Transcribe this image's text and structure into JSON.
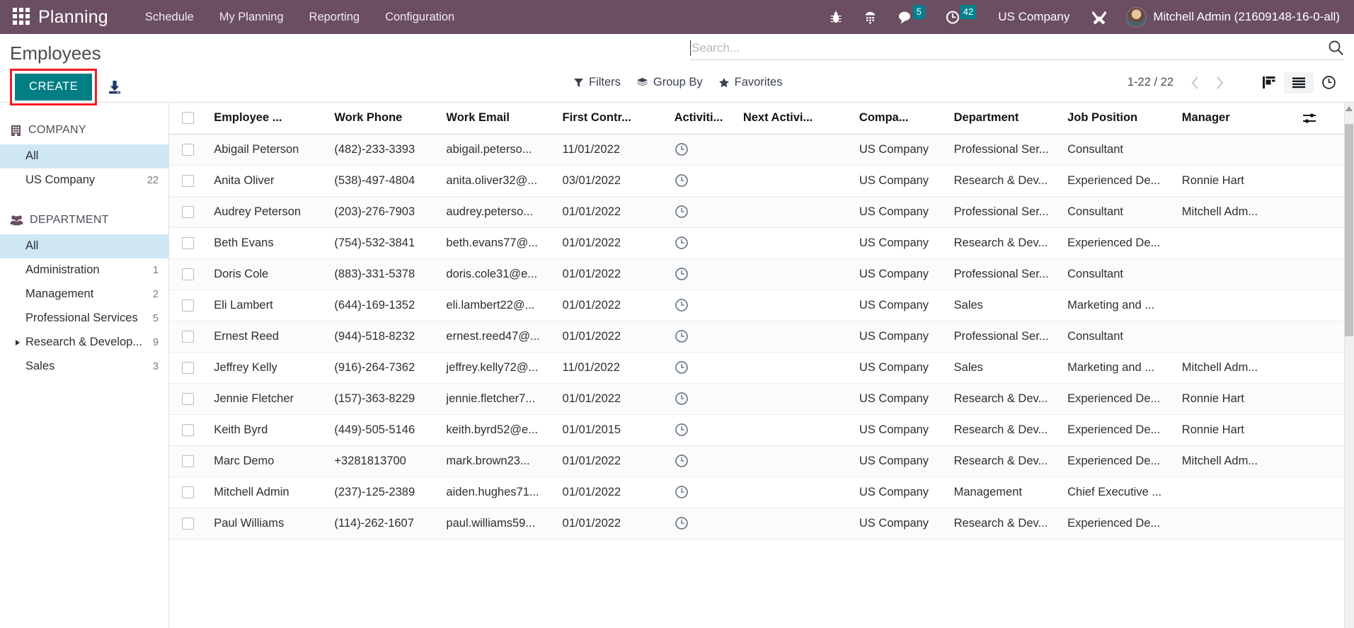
{
  "navbar": {
    "apps_icon": "apps-grid-icon",
    "brand": "Planning",
    "menu": [
      {
        "label": "Schedule"
      },
      {
        "label": "My Planning"
      },
      {
        "label": "Reporting"
      },
      {
        "label": "Configuration"
      }
    ],
    "icons": [
      {
        "name": "bug-icon"
      },
      {
        "name": "dialpad-icon"
      },
      {
        "name": "messages-icon",
        "badge": "5"
      },
      {
        "name": "activities-clock-icon",
        "badge": "42"
      }
    ],
    "company": "US Company",
    "tools_icon": "tools-icon",
    "user": "Mitchell Admin (21609148-16-0-all)",
    "background_color": "#6b4e62",
    "badge_color": "#00828e"
  },
  "control_panel": {
    "title": "Employees",
    "create_label": "CREATE",
    "create_color": "#017e84",
    "highlight_color": "#f51b22",
    "import_icon": "import-download-icon",
    "search": {
      "placeholder": "Search...",
      "value": "",
      "search_icon": "search-icon"
    },
    "filters": [
      {
        "label": "Filters",
        "icon": "funnel-icon"
      },
      {
        "label": "Group By",
        "icon": "layers-icon"
      },
      {
        "label": "Favorites",
        "icon": "star-icon"
      }
    ],
    "pager": {
      "range": "1-22 / 22",
      "prev_icon": "chevron-left-icon",
      "next_icon": "chevron-right-icon"
    },
    "views": [
      {
        "name": "kanban-view",
        "icon": "kanban-icon",
        "active": false
      },
      {
        "name": "list-view",
        "icon": "list-icon",
        "active": true
      },
      {
        "name": "activity-view",
        "icon": "clock-icon",
        "active": false
      }
    ]
  },
  "sidebar": {
    "sections": [
      {
        "title": "COMPANY",
        "icon": "building-icon",
        "items": [
          {
            "label": "All",
            "count": "",
            "selected": true,
            "expandable": false
          },
          {
            "label": "US Company",
            "count": "22",
            "selected": false,
            "expandable": false
          }
        ]
      },
      {
        "title": "DEPARTMENT",
        "icon": "people-icon",
        "items": [
          {
            "label": "All",
            "count": "",
            "selected": true,
            "expandable": false
          },
          {
            "label": "Administration",
            "count": "1",
            "selected": false,
            "expandable": false
          },
          {
            "label": "Management",
            "count": "2",
            "selected": false,
            "expandable": false
          },
          {
            "label": "Professional Services",
            "count": "5",
            "selected": false,
            "expandable": false
          },
          {
            "label": "Research & Develop...",
            "count": "9",
            "selected": false,
            "expandable": true
          },
          {
            "label": "Sales",
            "count": "3",
            "selected": false,
            "expandable": false
          }
        ]
      }
    ]
  },
  "table": {
    "headers": [
      "Employee ...",
      "Work Phone",
      "Work Email",
      "First Contr...",
      "Activiti...",
      "Next Activi...",
      "Compa...",
      "Department",
      "Job Position",
      "Manager"
    ],
    "options_icon": "column-options-icon",
    "rows": [
      {
        "name": "Abigail Peterson",
        "phone": "(482)-233-3393",
        "email": "abigail.peterso...",
        "contract": "11/01/2022",
        "activity": "clock-icon",
        "next_activity": "",
        "company": "US Company",
        "department": "Professional Ser...",
        "job": "Consultant",
        "manager": ""
      },
      {
        "name": "Anita Oliver",
        "phone": "(538)-497-4804",
        "email": "anita.oliver32@...",
        "contract": "03/01/2022",
        "activity": "clock-icon",
        "next_activity": "",
        "company": "US Company",
        "department": "Research & Dev...",
        "job": "Experienced De...",
        "manager": "Ronnie Hart"
      },
      {
        "name": "Audrey Peterson",
        "phone": "(203)-276-7903",
        "email": "audrey.peterso...",
        "contract": "01/01/2022",
        "activity": "clock-icon",
        "next_activity": "",
        "company": "US Company",
        "department": "Professional Ser...",
        "job": "Consultant",
        "manager": "Mitchell Adm..."
      },
      {
        "name": "Beth Evans",
        "phone": "(754)-532-3841",
        "email": "beth.evans77@...",
        "contract": "01/01/2022",
        "activity": "clock-icon",
        "next_activity": "",
        "company": "US Company",
        "department": "Research & Dev...",
        "job": "Experienced De...",
        "manager": ""
      },
      {
        "name": "Doris Cole",
        "phone": "(883)-331-5378",
        "email": "doris.cole31@e...",
        "contract": "01/01/2022",
        "activity": "clock-icon",
        "next_activity": "",
        "company": "US Company",
        "department": "Professional Ser...",
        "job": "Consultant",
        "manager": ""
      },
      {
        "name": "Eli Lambert",
        "phone": "(644)-169-1352",
        "email": "eli.lambert22@...",
        "contract": "01/01/2022",
        "activity": "clock-icon",
        "next_activity": "",
        "company": "US Company",
        "department": "Sales",
        "job": "Marketing and ...",
        "manager": ""
      },
      {
        "name": "Ernest Reed",
        "phone": "(944)-518-8232",
        "email": "ernest.reed47@...",
        "contract": "01/01/2022",
        "activity": "clock-icon",
        "next_activity": "",
        "company": "US Company",
        "department": "Professional Ser...",
        "job": "Consultant",
        "manager": ""
      },
      {
        "name": "Jeffrey Kelly",
        "phone": "(916)-264-7362",
        "email": "jeffrey.kelly72@...",
        "contract": "11/01/2022",
        "activity": "clock-icon",
        "next_activity": "",
        "company": "US Company",
        "department": "Sales",
        "job": "Marketing and ...",
        "manager": "Mitchell Adm..."
      },
      {
        "name": "Jennie Fletcher",
        "phone": "(157)-363-8229",
        "email": "jennie.fletcher7...",
        "contract": "01/01/2022",
        "activity": "clock-icon",
        "next_activity": "",
        "company": "US Company",
        "department": "Research & Dev...",
        "job": "Experienced De...",
        "manager": "Ronnie Hart"
      },
      {
        "name": "Keith Byrd",
        "phone": "(449)-505-5146",
        "email": "keith.byrd52@e...",
        "contract": "01/01/2015",
        "activity": "clock-icon",
        "next_activity": "",
        "company": "US Company",
        "department": "Research & Dev...",
        "job": "Experienced De...",
        "manager": "Ronnie Hart"
      },
      {
        "name": "Marc Demo",
        "phone": "+3281813700",
        "email": "mark.brown23...",
        "contract": "01/01/2022",
        "activity": "clock-icon",
        "next_activity": "",
        "company": "US Company",
        "department": "Research & Dev...",
        "job": "Experienced De...",
        "manager": "Mitchell Adm..."
      },
      {
        "name": "Mitchell Admin",
        "phone": "(237)-125-2389",
        "email": "aiden.hughes71...",
        "contract": "01/01/2022",
        "activity": "clock-icon",
        "next_activity": "",
        "company": "US Company",
        "department": "Management",
        "job": "Chief Executive ...",
        "manager": ""
      },
      {
        "name": "Paul Williams",
        "phone": "(114)-262-1607",
        "email": "paul.williams59...",
        "contract": "01/01/2022",
        "activity": "clock-icon",
        "next_activity": "",
        "company": "US Company",
        "department": "Research & Dev...",
        "job": "Experienced De...",
        "manager": ""
      }
    ]
  }
}
